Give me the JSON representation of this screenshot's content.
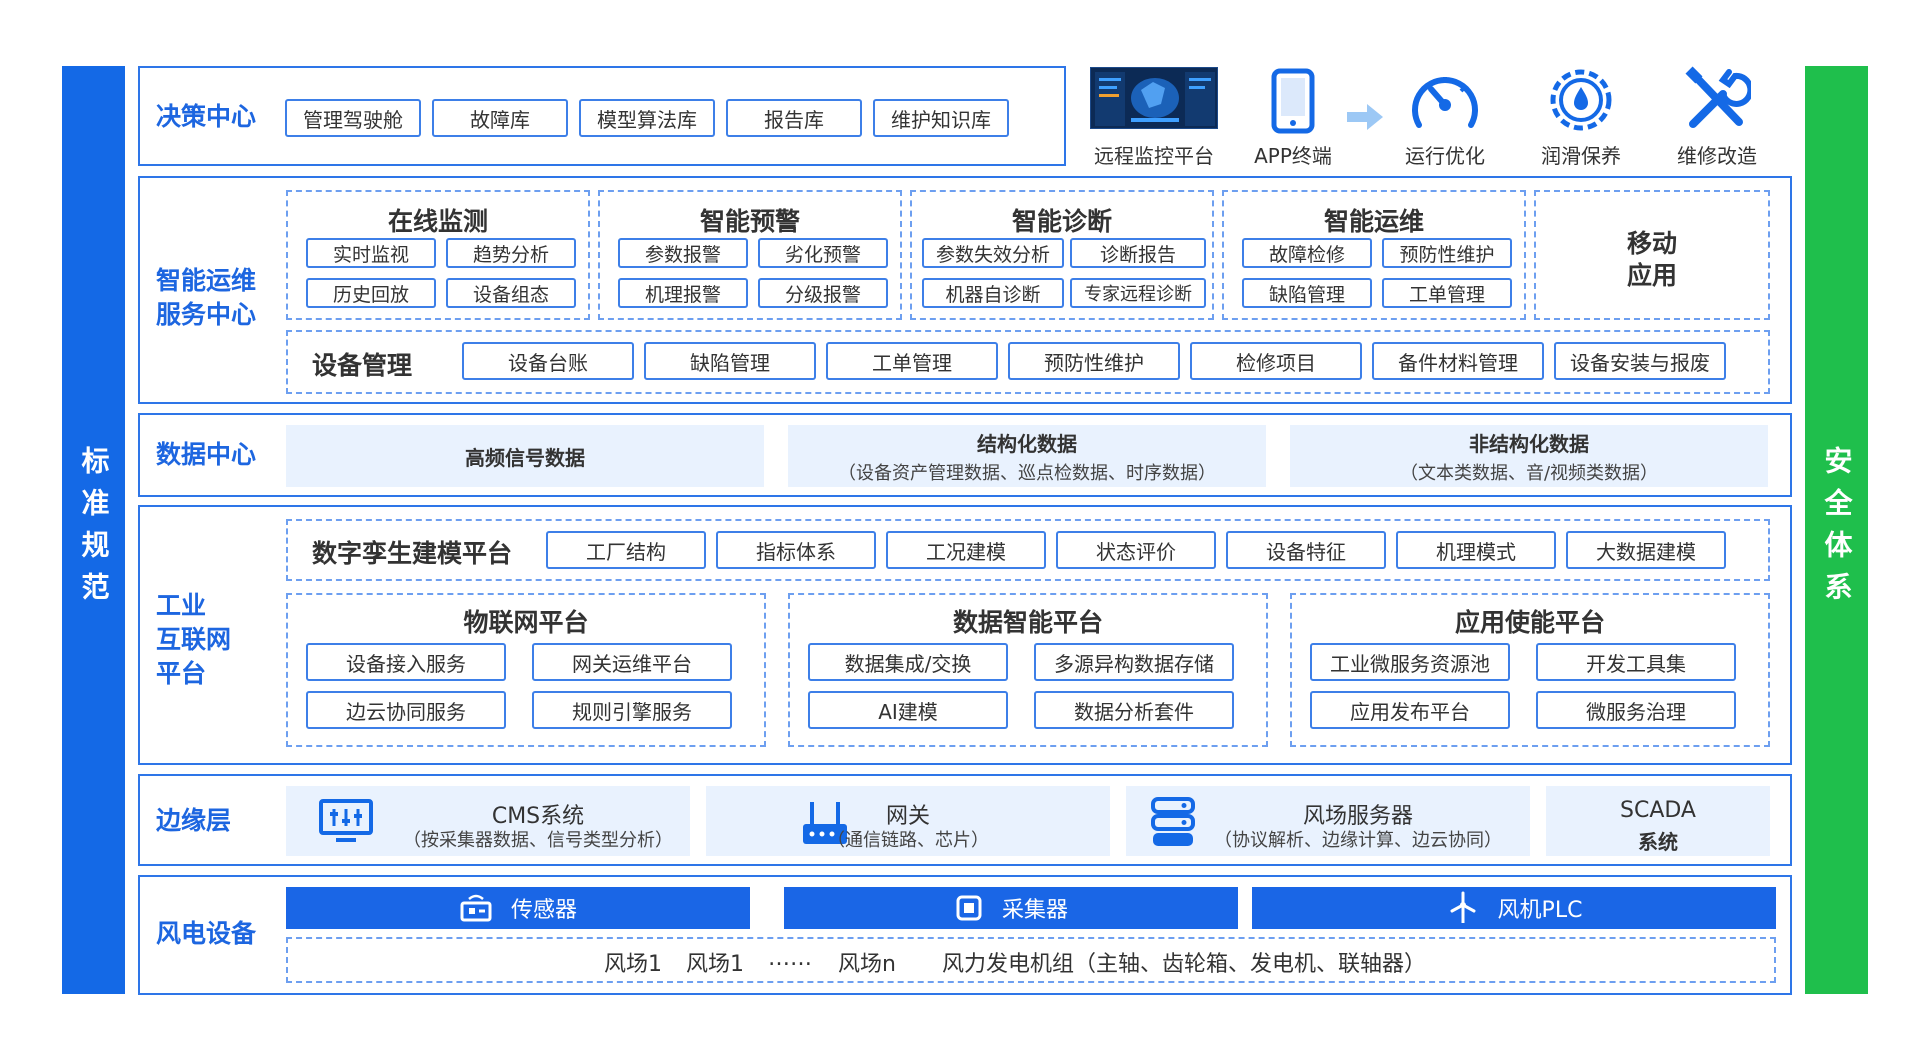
{
  "side_left": "标准规范",
  "side_right": "安全体系",
  "decision": {
    "title": "决策中心",
    "buttons": [
      "管理驾驶舱",
      "故障库",
      "模型算法库",
      "报告库",
      "维护知识库"
    ],
    "icons": [
      {
        "icon": "dashboard-screen-icon",
        "label": "远程监控平台"
      },
      {
        "icon": "mobile-phone-icon",
        "label": "APP终端"
      },
      {
        "icon": "gauge-icon",
        "label": "运行优化"
      },
      {
        "icon": "lubrication-gear-icon",
        "label": "润滑保养"
      },
      {
        "icon": "wrench-screwdriver-icon",
        "label": "维修改造"
      }
    ]
  },
  "smart_ops": {
    "title_line1": "智能运维",
    "title_line2": "服务中心",
    "groups": [
      {
        "title": "在线监测",
        "items": [
          "实时监视",
          "趋势分析",
          "历史回放",
          "设备组态"
        ]
      },
      {
        "title": "智能预警",
        "items": [
          "参数报警",
          "劣化预警",
          "机理报警",
          "分级报警"
        ]
      },
      {
        "title": "智能诊断",
        "items": [
          "参数失效分析",
          "诊断报告",
          "机器自诊断",
          "专家远程诊断"
        ]
      },
      {
        "title": "智能运维",
        "items": [
          "故障检修",
          "预防性维护",
          "缺陷管理",
          "工单管理"
        ]
      }
    ],
    "mobile_line1": "移动",
    "mobile_line2": "应用",
    "equip_mgmt": {
      "title": "设备管理",
      "items": [
        "设备台账",
        "缺陷管理",
        "工单管理",
        "预防性维护",
        "检修项目",
        "备件材料管理",
        "设备安装与报废"
      ]
    }
  },
  "data_center": {
    "title": "数据中心",
    "blocks": [
      {
        "title": "高频信号数据",
        "sub": ""
      },
      {
        "title": "结构化数据",
        "sub": "（设备资产管理数据、巡点检数据、时序数据）"
      },
      {
        "title": "非结构化数据",
        "sub": "（文本类数据、音/视频类数据）"
      }
    ]
  },
  "iiot": {
    "title_line1": "工业",
    "title_line2": "互联网",
    "title_line3": "平台",
    "twin": {
      "title": "数字孪生建模平台",
      "items": [
        "工厂结构",
        "指标体系",
        "工况建模",
        "状态评价",
        "设备特征",
        "机理模式",
        "大数据建模"
      ]
    },
    "platforms": [
      {
        "title": "物联网平台",
        "items": [
          "设备接入服务",
          "网关运维平台",
          "边云协同服务",
          "规则引擎服务"
        ]
      },
      {
        "title": "数据智能平台",
        "items": [
          "数据集成/交换",
          "多源异构数据存储",
          "AI建模",
          "数据分析套件"
        ]
      },
      {
        "title": "应用使能平台",
        "items": [
          "工业微服务资源池",
          "开发工具集",
          "应用发布平台",
          "微服务治理"
        ]
      }
    ]
  },
  "edge": {
    "title": "边缘层",
    "blocks": [
      {
        "icon": "monitor-icon",
        "title": "CMS系统",
        "sub": "（按采集器数据、信号类型分析）"
      },
      {
        "icon": "router-icon",
        "title": "网关",
        "sub": "（通信链路、芯片）"
      },
      {
        "icon": "server-icon",
        "title": "风场服务器",
        "sub": "（协议解析、边缘计算、边云协同）"
      },
      {
        "icon": "",
        "title": "SCADA",
        "sub": "系统"
      }
    ]
  },
  "wind": {
    "title": "风电设备",
    "bars": [
      {
        "icon": "sensor-icon",
        "label": "传感器"
      },
      {
        "icon": "chip-icon",
        "label": "采集器"
      },
      {
        "icon": "wind-turbine-icon",
        "label": "风机PLC"
      }
    ],
    "farms": [
      "风场1",
      "风场1",
      "……",
      "风场n",
      "风力发电机组（主轴、齿轮箱、发电机、联轴器）"
    ]
  },
  "colors": {
    "primary": "#1469e6",
    "accent_green": "#1fbf4c",
    "light_fill": "#e9f2fe"
  }
}
